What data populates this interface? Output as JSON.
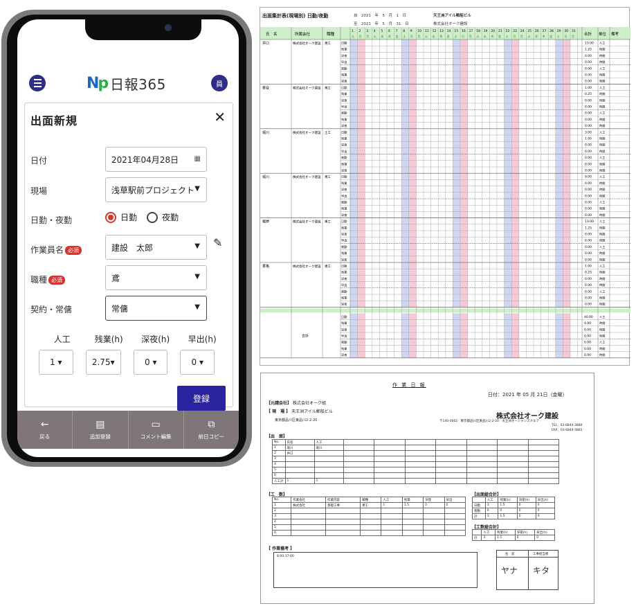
{
  "app": {
    "logo_mark": "N",
    "logo_mark2": "p",
    "logo_text": "日報365",
    "user_badge": "員"
  },
  "form": {
    "title": "出面新規",
    "close": "✕",
    "date_label": "日付",
    "date_value": "2021年04月28日",
    "site_label": "現場",
    "site_value": "浅草駅前プロジェクト",
    "shift_label": "日勤・夜勤",
    "shift_day": "日勤",
    "shift_night": "夜勤",
    "worker_label": "作業員名",
    "required": "必須",
    "worker_value": "建設　太郎",
    "job_label": "職種",
    "job_value": "鳶",
    "contract_label": "契約・常傭",
    "contract_value": "常傭",
    "hours_labels": [
      "人工",
      "残業(h)",
      "深夜(h)",
      "早出(h)"
    ],
    "hours_values": [
      "1",
      "2.75",
      "0",
      "0"
    ],
    "register": "登録"
  },
  "bottom_nav": [
    {
      "icon": "←",
      "label": "戻る"
    },
    {
      "icon": "▤",
      "label": "追加登録"
    },
    {
      "icon": "▭",
      "label": "コメント編集"
    },
    {
      "icon": "⧉",
      "label": "前日コピー"
    }
  ],
  "report1": {
    "title": "出面集計表(現場別) 日勤/夜勤",
    "period_from": "自　2021　年　5　月　1　日",
    "period_to": "至　2021　年　5　月　31　日",
    "site": "天王洲アイル郵船ビル",
    "company": "株式会社オーク建設",
    "header_name": "氏　名",
    "header_company": "所属会社",
    "header_job": "職種",
    "header_total": "合計",
    "header_unit": "単位",
    "header_note": "備考",
    "grand_total_label": "合計",
    "workers": [
      {
        "name": "井口",
        "company": "株式会社オーク建設",
        "job": "鳶工",
        "totals": [
          "13.00",
          "1.25",
          "0.00",
          "0.00",
          "0.00",
          "0.00",
          "0.00"
        ]
      },
      {
        "name": "菱谷",
        "company": "株式会社オーク建設",
        "job": "鳶工",
        "totals": [
          "1.00",
          "0.25",
          "0.00",
          "0.00",
          "0.00",
          "0.00",
          "0.00"
        ]
      },
      {
        "name": "堀川",
        "company": "株式会社オーク建設",
        "job": "土工",
        "totals": [
          "3.00",
          "1.00",
          "0.00",
          "0.00",
          "0.00",
          "0.00",
          "0.00"
        ]
      },
      {
        "name": "堀川",
        "company": "株式会社オーク建設",
        "job": "鳶工",
        "totals": [
          "9.00",
          "0.00",
          "0.00",
          "0.00",
          "0.00",
          "0.00",
          "0.00"
        ]
      },
      {
        "name": "根岸",
        "company": "株式会社オーク建設",
        "job": "鳶工",
        "totals": [
          "13.00",
          "1.25",
          "0.00",
          "0.00",
          "0.00",
          "0.00",
          "0.00"
        ]
      },
      {
        "name": "貫格",
        "company": "株式会社オーク建設",
        "job": "鳶工",
        "totals": [
          "1.00",
          "0.25",
          "0.00",
          "0.00",
          "0.00",
          "0.00",
          "0.00"
        ]
      }
    ],
    "row_kinds": [
      "日勤",
      "残業",
      "深夜",
      "早出",
      "夜勤",
      "残業",
      "深夜"
    ],
    "units": [
      "人工",
      "時間",
      "時間",
      "時間",
      "人工",
      "時間",
      "時間"
    ],
    "grand_totals": [
      "40.00",
      "4.00",
      "0.00",
      "0.00",
      "0.00",
      "0.00",
      "0.00"
    ]
  },
  "report2": {
    "title": "作 業 日 報",
    "date": "日付：2021 年 05 月 21日（金曜）",
    "prime_label": "【元請会社】",
    "prime_value": "株式会社オーク組",
    "site_label": "【 現　場 】",
    "site_value": "天王洲アイル郵船ビル",
    "site_address": "東京都品川区東品川2-2-20",
    "company": "株式会社オーク建設",
    "company_address": "〒140-0002　東京都品川区東品川2-2-20　天王洲オーシャンスクエア",
    "company_tel": "TEL：03-6844-3880",
    "company_fax": "FAX：03-6844-3881",
    "attendance_label": "【出　面】",
    "work_label": "【工　数】",
    "attendance_total_label": "【出面総合計】",
    "work_total_label": "【工数総合計】",
    "remarks_label": "【 作業備考 】",
    "remarks_value": "8:00-17:00",
    "sign_label1": "名　前",
    "sign_label2": "工事担当者",
    "sign1": "ヤナ",
    "sign2": "キタ"
  }
}
